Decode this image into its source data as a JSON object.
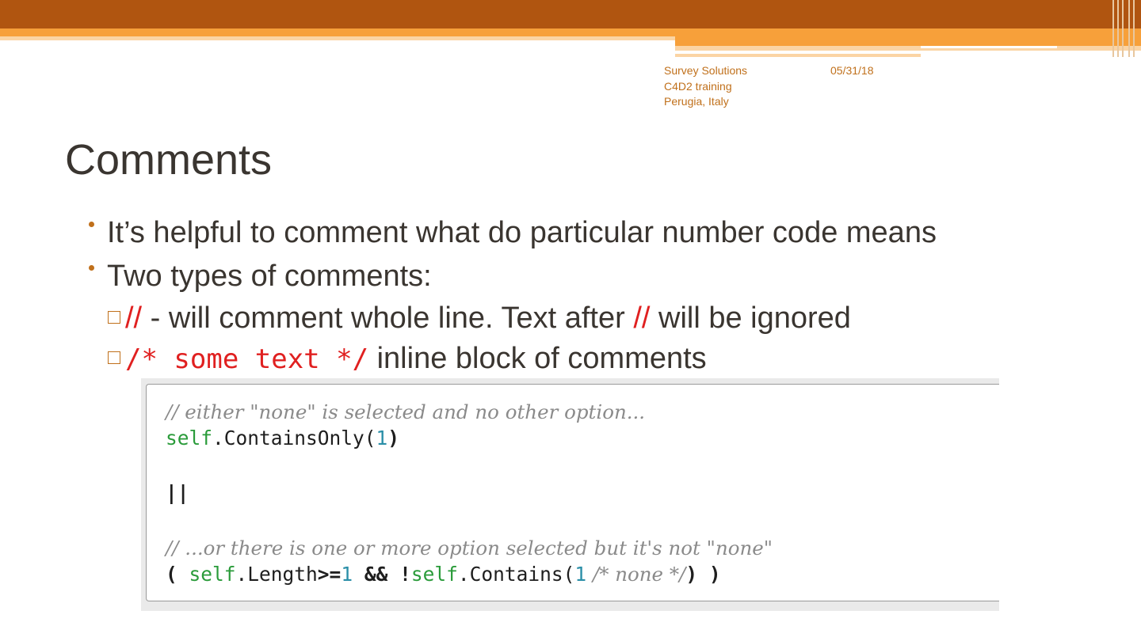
{
  "header": {
    "org": "Survey Solutions",
    "event": "C4D2 training",
    "location": "Perugia, Italy",
    "date": "05/31/18"
  },
  "slide": {
    "title": "Comments",
    "bullet1": "It’s helpful to comment what do particular number code means",
    "bullet2": "Two types of comments:",
    "sub1_marker": "//",
    "sub1_text_a": " - will comment whole line. Text after ",
    "sub1_marker2": "//",
    "sub1_text_b": " will be ignored",
    "sub2_marker": "/* some text */",
    "sub2_text": " inline block of comments"
  },
  "code": {
    "line1_comment": "// either \"none\" is selected and no other option...",
    "line2_self": "self",
    "line2_call": ".ContainsOnly(",
    "line2_num": "1",
    "line2_close": ")",
    "line3_or": "||",
    "line4_comment": "// ...or there is one or more option selected but it's not \"none\"",
    "line5_open": "( ",
    "line5_self1": "self",
    "line5_length": ".Length",
    "line5_gte": ">=",
    "line5_num1": "1",
    "line5_and": " && ",
    "line5_not": "!",
    "line5_self2": "self",
    "line5_contains": ".Contains(",
    "line5_num2": "1",
    "line5_inline_comment": " /* none */",
    "line5_close": ") )"
  },
  "colors": {
    "banner_dark": "#b05510",
    "banner_orange": "#f7a03a",
    "accent": "#c0701b",
    "comment_red": "#e02020"
  }
}
